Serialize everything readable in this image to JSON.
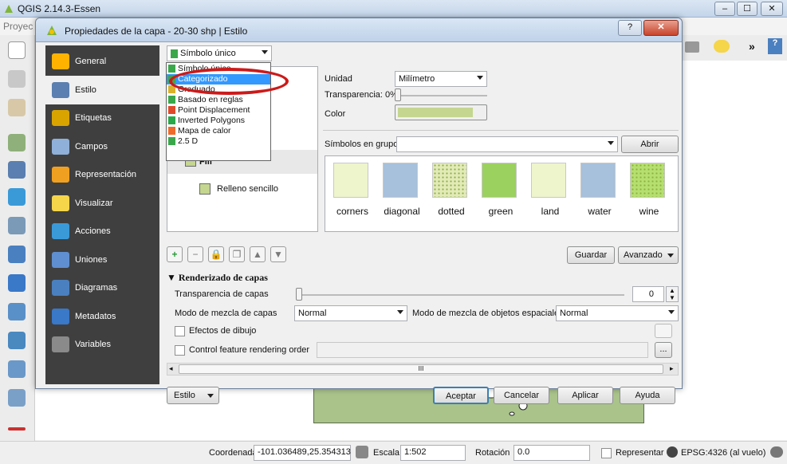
{
  "app": {
    "title": "QGIS 2.14.3-Essen",
    "menu_first": "Proyec",
    "win_buttons": [
      "–",
      "☐",
      "✕"
    ]
  },
  "dialog": {
    "title": "Propiedades de la capa - 20-30 shp | Estilo",
    "help": "?",
    "close": "✕"
  },
  "sidebar": {
    "items": [
      {
        "label": "General",
        "icon": "wrench-icon",
        "color": "#ffb300"
      },
      {
        "label": "Estilo",
        "icon": "paintbrush-icon",
        "color": "#5a7fb0"
      },
      {
        "label": "Etiquetas",
        "icon": "abc-label-icon",
        "color": "#d9a400"
      },
      {
        "label": "Campos",
        "icon": "table-icon",
        "color": "#8fb0d8"
      },
      {
        "label": "Representación",
        "icon": "brush-icon",
        "color": "#f0a020"
      },
      {
        "label": "Visualizar",
        "icon": "speech-bubble-icon",
        "color": "#f5d54a"
      },
      {
        "label": "Acciones",
        "icon": "gear-icon",
        "color": "#3a9ad8"
      },
      {
        "label": "Uniones",
        "icon": "join-icon",
        "color": "#5f8fd0"
      },
      {
        "label": "Diagramas",
        "icon": "diagram-icon",
        "color": "#4a80c0"
      },
      {
        "label": "Metadatos",
        "icon": "info-icon",
        "color": "#3a78c8"
      },
      {
        "label": "Variables",
        "icon": "epsilon-icon",
        "color": "#8a8a8a"
      }
    ]
  },
  "renderer": {
    "selected": "Símbolo único",
    "options": [
      {
        "label": "Símbolo único",
        "color": "#3aa84a"
      },
      {
        "label": "Categorizado",
        "color": "#3aa84a"
      },
      {
        "label": "Graduado",
        "color": "#d8b22a"
      },
      {
        "label": "Basado en reglas",
        "color": "#3aa84a"
      },
      {
        "label": "Point Displacement",
        "color": "#e04a2a"
      },
      {
        "label": "Inverted Polygons",
        "color": "#2aa84a"
      },
      {
        "label": "Mapa de calor",
        "color": "#f06a2a"
      },
      {
        "label": "2.5 D",
        "color": "#3aa84a"
      }
    ]
  },
  "symbol_tree": {
    "root": "Fill",
    "child": "Relleno sencillo"
  },
  "symbol_props": {
    "unit_label": "Unidad",
    "unit_value": "Milímetro",
    "transparency_label": "Transparencia: 0%",
    "color_label": "Color",
    "color_value": "#c5d690",
    "group_label": "Símbolos en grupo",
    "group_value": "",
    "open_library": "Abrir biblioteca"
  },
  "symbols": [
    {
      "name": "corners",
      "color": "#eef5cc"
    },
    {
      "name": "diagonal",
      "color": "#a7c0db"
    },
    {
      "name": "dotted",
      "color": "#e2eab8"
    },
    {
      "name": "green",
      "color": "#9bd15f"
    },
    {
      "name": "land",
      "color": "#eef5cc"
    },
    {
      "name": "water",
      "color": "#a7c0db"
    },
    {
      "name": "wine",
      "color": "#b5df6f"
    }
  ],
  "symbol_tools": {
    "add": "+",
    "remove": "−",
    "lock": "🔒",
    "duplicate": "❐",
    "up": "▲",
    "down": "▼"
  },
  "buttons": {
    "save": "Guardar",
    "advanced": "Avanzado",
    "style": "Estilo",
    "accept": "Aceptar",
    "cancel": "Cancelar",
    "apply": "Aplicar",
    "help": "Ayuda"
  },
  "layer_rendering": {
    "section_title": "Renderizado de capas",
    "transparency_label": "Transparencia de capas",
    "transparency_value": "0",
    "blend_label": "Modo de mezcla de capas",
    "blend_value": "Normal",
    "feature_blend_label": "Modo de mezcla de objetos espaciales",
    "feature_blend_value": "Normal",
    "draw_effects_label": "Efectos de dibujo",
    "control_order_label": "Control feature rendering order",
    "ellipsis": "...",
    "scroll_mark": "III"
  },
  "status_bar": {
    "coord_label": "Coordenada",
    "coord_value": "-101.036489,25.354313",
    "scale_label": "Escala",
    "scale_value": "1:502",
    "rotation_label": "Rotación",
    "rotation_value": "0.0",
    "render_label": "Representar",
    "crs_label": "EPSG:4326 (al vuelo)"
  },
  "colors": {
    "sidebar_bg": "#3f3f3f",
    "highlight": "#3399ff",
    "annotation_red": "#cc1a1a"
  }
}
